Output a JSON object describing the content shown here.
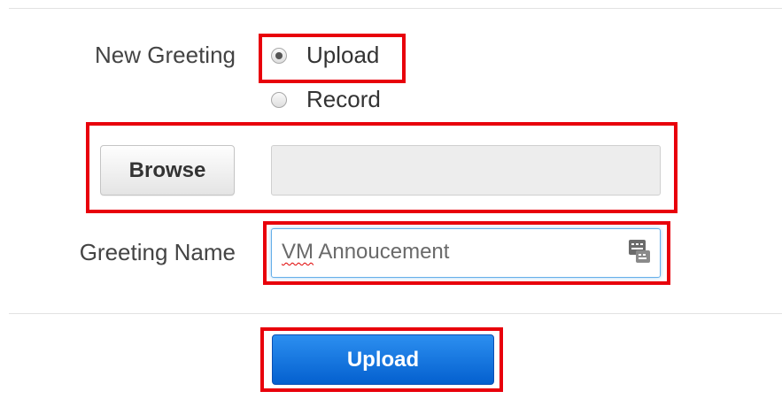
{
  "form": {
    "new_greeting_label": "New Greeting",
    "options": {
      "upload_label": "Upload",
      "record_label": "Record",
      "selected": "Upload"
    },
    "browse_label": "Browse",
    "file_path_value": "",
    "greeting_name_label": "Greeting Name",
    "greeting_name_value": "VM Annoucement",
    "greeting_name_first_word": "VM",
    "greeting_name_rest": " Annoucement",
    "submit_label": "Upload"
  },
  "colors": {
    "highlight": "#e8000b",
    "primary_button": "#0460cf",
    "focus_border": "#66afe9"
  },
  "icons": {
    "input_tool": "keyboard-suggestion-icon"
  }
}
